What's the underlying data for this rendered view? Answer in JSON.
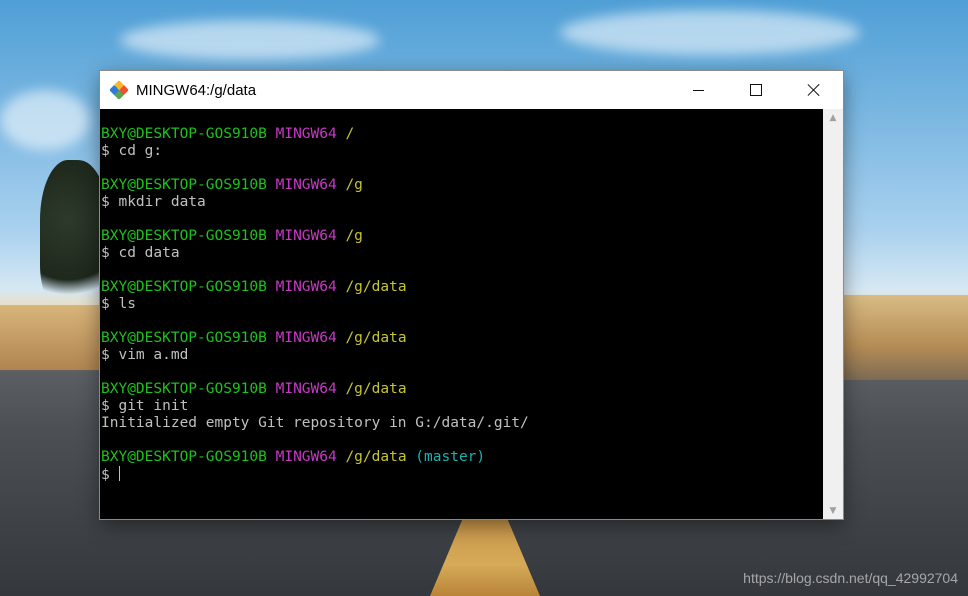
{
  "window": {
    "title": "MINGW64:/g/data",
    "controls": {
      "minimize": "minimize-icon",
      "maximize": "maximize-icon",
      "close": "close-icon"
    }
  },
  "terminal": {
    "blocks": [
      {
        "user_host": "BXY@DESKTOP-GOS910B",
        "env": "MINGW64",
        "path": "/",
        "branch": "",
        "command": "$ cd g:",
        "output": ""
      },
      {
        "user_host": "BXY@DESKTOP-GOS910B",
        "env": "MINGW64",
        "path": "/g",
        "branch": "",
        "command": "$ mkdir data",
        "output": ""
      },
      {
        "user_host": "BXY@DESKTOP-GOS910B",
        "env": "MINGW64",
        "path": "/g",
        "branch": "",
        "command": "$ cd data",
        "output": ""
      },
      {
        "user_host": "BXY@DESKTOP-GOS910B",
        "env": "MINGW64",
        "path": "/g/data",
        "branch": "",
        "command": "$ ls",
        "output": ""
      },
      {
        "user_host": "BXY@DESKTOP-GOS910B",
        "env": "MINGW64",
        "path": "/g/data",
        "branch": "",
        "command": "$ vim a.md",
        "output": ""
      },
      {
        "user_host": "BXY@DESKTOP-GOS910B",
        "env": "MINGW64",
        "path": "/g/data",
        "branch": "",
        "command": "$ git init",
        "output": "Initialized empty Git repository in G:/data/.git/"
      },
      {
        "user_host": "BXY@DESKTOP-GOS910B",
        "env": "MINGW64",
        "path": "/g/data",
        "branch": "(master)",
        "command": "$ ",
        "output": ""
      }
    ]
  },
  "watermark": "https://blog.csdn.net/qq_42992704",
  "colors": {
    "prompt_user": "#1bc31b",
    "prompt_env": "#c838c6",
    "prompt_path": "#c6c532",
    "prompt_branch": "#18b2b2",
    "text": "#c0c0c0",
    "terminal_bg": "#000000"
  }
}
